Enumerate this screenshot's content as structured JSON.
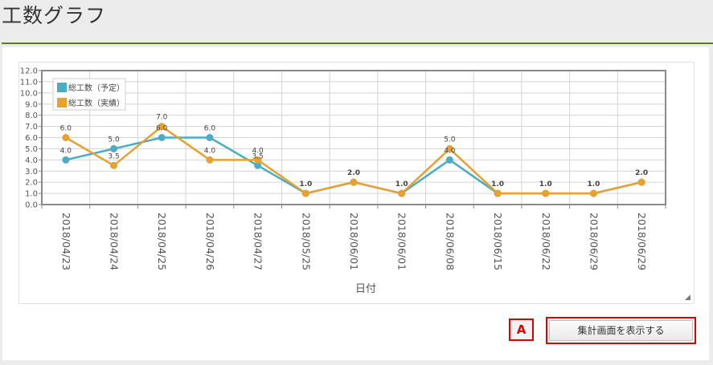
{
  "page": {
    "title": "工数グラフ"
  },
  "buttons": {
    "badge_label": "A",
    "summary_label": "集計画面を表示する"
  },
  "colors": {
    "planned": "#4bacc6",
    "actual": "#e8a02f",
    "rule": "#5a7a1e"
  },
  "chart_data": {
    "type": "line",
    "title": "",
    "xlabel": "日付",
    "ylabel": "",
    "ylim": [
      0,
      12
    ],
    "ytick_step": 1,
    "grid": true,
    "legend_position": "top-left",
    "categories": [
      "2018/04/23",
      "2018/04/24",
      "2018/04/25",
      "2018/04/26",
      "2018/04/27",
      "2018/05/25",
      "2018/06/01",
      "2018/06/01",
      "2018/06/08",
      "2018/06/15",
      "2018/06/22",
      "2018/06/29",
      "2018/06/29"
    ],
    "series": [
      {
        "name": "総工数（予定）",
        "color": "#4bacc6",
        "values": [
          4.0,
          5.0,
          6.0,
          6.0,
          3.5,
          1.0,
          2.0,
          1.0,
          4.0,
          1.0,
          1.0,
          1.0,
          2.0
        ]
      },
      {
        "name": "総工数（実績）",
        "color": "#e8a02f",
        "values": [
          6.0,
          3.5,
          7.0,
          4.0,
          4.0,
          1.0,
          2.0,
          1.0,
          5.0,
          1.0,
          1.0,
          1.0,
          2.0
        ]
      }
    ]
  }
}
